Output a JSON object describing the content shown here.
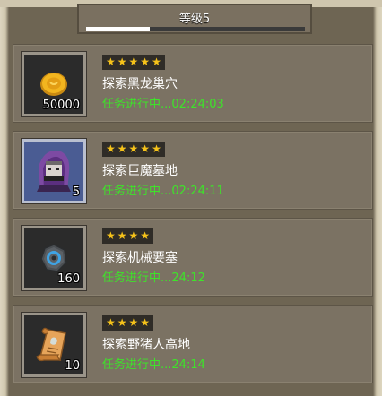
{
  "level": {
    "title": "等级5",
    "progress": 0.29
  },
  "quests": [
    {
      "stars": 5,
      "name": "探索黑龙巢穴",
      "status": "任务进行中...02:24:03",
      "reward_count": "50000",
      "reward_icon": "gold-coin-icon"
    },
    {
      "stars": 5,
      "name": "探索巨魔墓地",
      "status": "任务进行中...02:24:11",
      "reward_count": "5",
      "reward_icon": "hooded-hero-icon"
    },
    {
      "stars": 4,
      "name": "探索机械要塞",
      "status": "任务进行中...24:12",
      "reward_count": "160",
      "reward_icon": "gear-stone-icon"
    },
    {
      "stars": 4,
      "name": "探索野猪人高地",
      "status": "任务进行中...24:14",
      "reward_count": "10",
      "reward_icon": "scroll-icon"
    }
  ]
}
